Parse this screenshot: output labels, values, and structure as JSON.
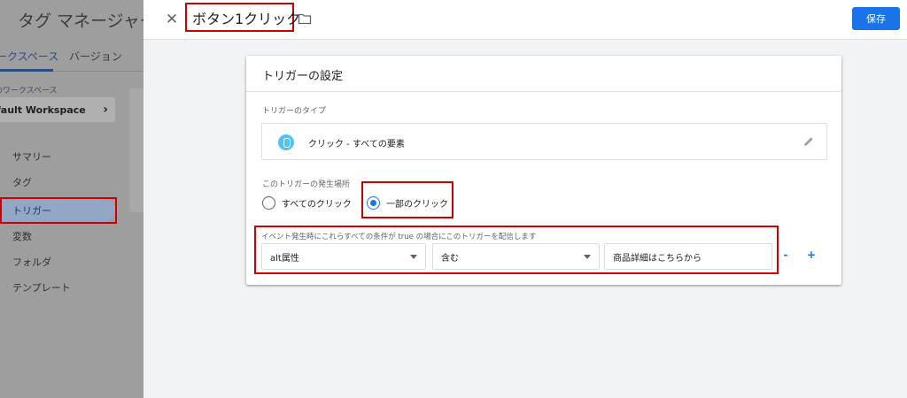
{
  "background_app": {
    "app_title": "タグ マネージャー",
    "tabs": {
      "workspace": "ークスペース",
      "versions": "バージョン"
    },
    "workspace_label": "のワークスペース",
    "workspace_name": "fault Workspace",
    "nav": [
      "サマリー",
      "タグ",
      "トリガー",
      "変数",
      "フォルダ",
      "テンプレート"
    ],
    "active_nav_index": 2
  },
  "header": {
    "close_icon": "close-icon",
    "trigger_name": "ボタン1クリック",
    "folder_icon": "folder-icon",
    "save_label": "保存"
  },
  "card": {
    "title": "トリガーの設定",
    "type_section_label": "トリガーのタイプ",
    "type_value": "クリック - すべての要素",
    "type_icon": "mouse-icon",
    "edit_icon": "pencil-icon",
    "fires_on_label": "このトリガーの発生場所",
    "options": {
      "all": "すべてのクリック",
      "some": "一部のクリック"
    },
    "selected_option": "some",
    "condition_label": "イベント発生時にこれらすべての条件が true の場合にこのトリガーを配信します",
    "condition": {
      "variable": "alt属性",
      "operator": "含む",
      "value": "商品詳細はこちらから"
    },
    "remove_label": "-",
    "add_label": "+"
  },
  "colors": {
    "accent": "#1a73e8",
    "highlight": "#cc0000",
    "icon_bg": "#4fc3f7"
  }
}
